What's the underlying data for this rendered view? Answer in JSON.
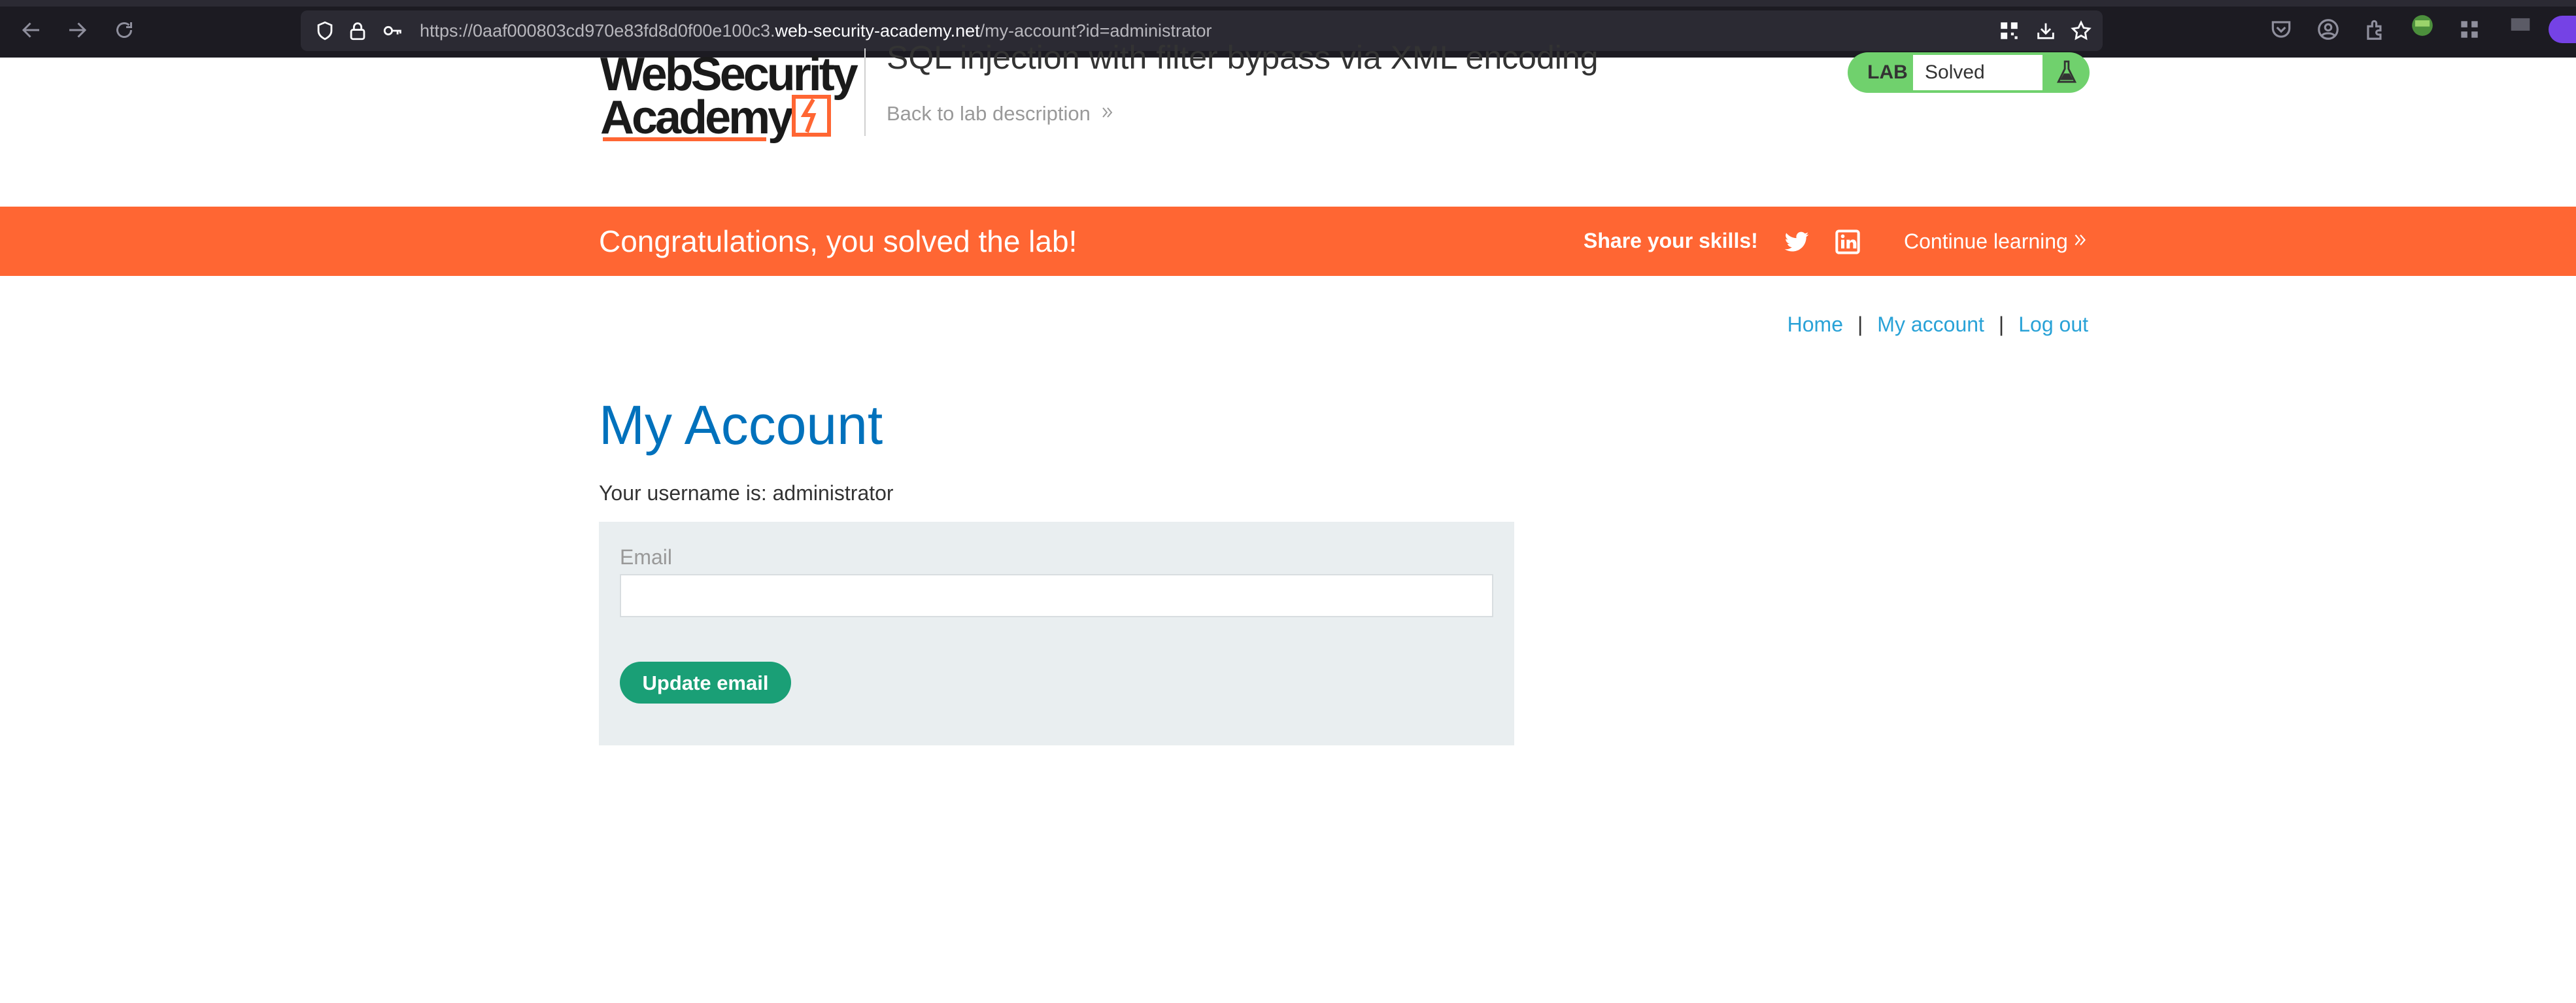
{
  "browser": {
    "url_prefix": "https://0aaf000803cd970e83fd8d0f00e100c3.",
    "url_host": "web-security-academy.net",
    "url_path": "/my-account?id=administrator"
  },
  "header": {
    "logo_line1": "WebSecurity",
    "logo_line2": "Academy",
    "lab_title": "SQL injection with filter bypass via XML encoding",
    "back_link": "Back to lab description",
    "badge_label": "LAB",
    "badge_status": "Solved"
  },
  "notification": {
    "message": "Congratulations, you solved the lab!",
    "share": "Share your skills!",
    "continue": "Continue learning"
  },
  "nav": {
    "home": "Home",
    "my_account": "My account",
    "log_out": "Log out",
    "sep": "|"
  },
  "main": {
    "title": "My Account",
    "username_text": "Your username is: administrator",
    "email_label": "Email",
    "email_value": "",
    "update_button": "Update email"
  },
  "colors": {
    "accent_orange": "#ff6633",
    "lab_green": "#70d16d",
    "link_blue": "#29a2d7",
    "title_blue": "#0071bc",
    "button_green": "#1a9f76"
  },
  "icons": [
    "back-icon",
    "forward-icon",
    "reload-icon",
    "shield-icon",
    "lock-icon",
    "key-icon",
    "qr-icon",
    "download-icon",
    "star-icon",
    "pocket-icon",
    "account-icon",
    "extensions-icon",
    "burp-icon",
    "grid-icon",
    "twitter-icon",
    "linkedin-icon",
    "flask-icon"
  ]
}
